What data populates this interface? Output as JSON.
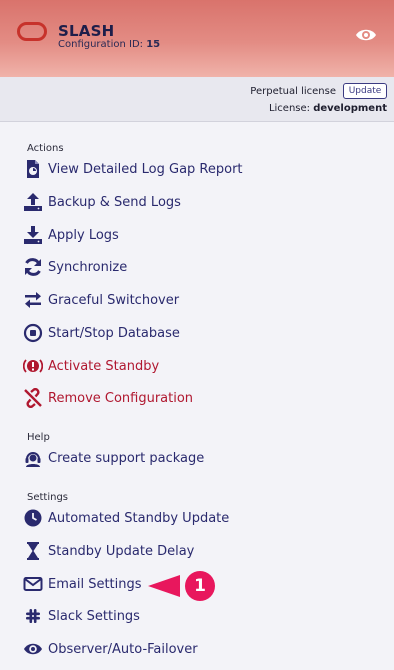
{
  "header": {
    "app_name": "SLASH",
    "config_label": "Configuration ID: ",
    "config_id": "15"
  },
  "license": {
    "type": "Perpetual license",
    "update_label": "Update",
    "license_label": "License: ",
    "license_value": "development"
  },
  "sections": {
    "actions": "Actions",
    "help": "Help",
    "settings": "Settings"
  },
  "items": {
    "log_gap": "View Detailed Log Gap Report",
    "backup": "Backup & Send Logs",
    "apply": "Apply Logs",
    "sync": "Synchronize",
    "switchover": "Graceful Switchover",
    "startstop": "Start/Stop Database",
    "activate": "Activate Standby",
    "remove": "Remove Configuration",
    "support": "Create support package",
    "auto_update": "Automated Standby Update",
    "delay": "Standby Update Delay",
    "email": "Email Settings",
    "slack": "Slack Settings",
    "observer": "Observer/Auto-Failover"
  },
  "callout": {
    "number": "1"
  },
  "colors": {
    "primary": "#2a2a6e",
    "danger": "#b01830",
    "callout": "#e8175d",
    "header_top": "#d9736c"
  }
}
